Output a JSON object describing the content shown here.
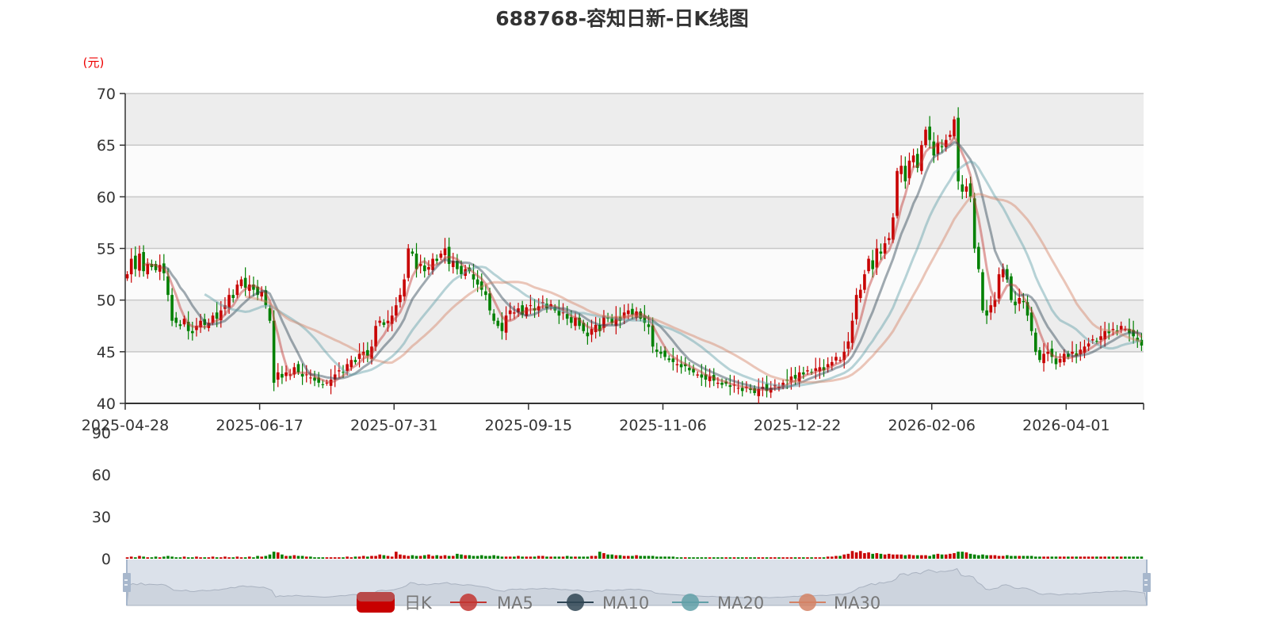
{
  "title": "688768-容知日新-日K线图",
  "unit_label": "(元)",
  "legend": [
    "日K",
    "MA5",
    "MA10",
    "MA20",
    "MA30"
  ],
  "colors": {
    "up": "#c80000",
    "down": "#008000",
    "MA5": "#c23531",
    "MA10": "#2f4554",
    "MA20": "#61a0a8",
    "MA30": "#d48265"
  },
  "chart_data": {
    "type": "candlestick",
    "title": "688768-容知日新-日K线图",
    "ylabel": "(元)",
    "ylim": [
      40,
      70
    ],
    "y_ticks": [
      "70",
      "65",
      "60",
      "55",
      "50",
      "45",
      "40"
    ],
    "volume_ylim": [
      0,
      90
    ],
    "volume_ticks": [
      "90",
      "60",
      "30",
      "0"
    ],
    "x_tick_labels": [
      "2025-04-28",
      "2025-06-17",
      "2025-07-31",
      "2025-09-15",
      "2025-11-06",
      "2025-12-22",
      "2026-02-06",
      "2026-04-01"
    ],
    "x_tick_every": 33,
    "ma_periods": [
      5,
      10,
      20,
      30
    ],
    "close": [
      52.5,
      54,
      53,
      54.5,
      52.8,
      53.5,
      53.2,
      52.9,
      53.4,
      52.6,
      50.5,
      48,
      47.8,
      47.5,
      48.2,
      47,
      46.8,
      47.5,
      48,
      47.6,
      47.8,
      48.5,
      48.2,
      49,
      49.5,
      50.5,
      50.2,
      51.5,
      52,
      51.2,
      51.5,
      51,
      50.5,
      50.8,
      49.5,
      48,
      42,
      43,
      42.5,
      43,
      42.8,
      43.5,
      43,
      42.6,
      42.8,
      42.5,
      42.2,
      42,
      41.8,
      42,
      42.3,
      42.8,
      43.2,
      43,
      43.8,
      44.2,
      44,
      44.8,
      45,
      44.6,
      45.5,
      47.5,
      48,
      47.6,
      48,
      48.5,
      49.5,
      50.5,
      52,
      55,
      54.5,
      53,
      53.5,
      52.8,
      53.2,
      54,
      53.8,
      54.5,
      55,
      53.5,
      53.8,
      53,
      52.5,
      53,
      52.8,
      52,
      51.5,
      51,
      50.5,
      49,
      48,
      47.5,
      47,
      48.5,
      49,
      48.8,
      49.2,
      48.6,
      49.3,
      49.5,
      49,
      49.4,
      49.8,
      49.2,
      49.6,
      49,
      48.5,
      48.8,
      48.2,
      47.8,
      48.3,
      47.5,
      47,
      46.5,
      47.2,
      47.6,
      47,
      48.5,
      48.2,
      47.8,
      48.4,
      48,
      48.8,
      49,
      48.6,
      48.9,
      48.2,
      47.8,
      47.4,
      45.5,
      45,
      44.8,
      44.5,
      44.2,
      44,
      43.8,
      43.5,
      43.6,
      43.2,
      43,
      42.8,
      42.5,
      42.3,
      42.6,
      42.2,
      42,
      41.8,
      41.9,
      41.6,
      41.8,
      41.5,
      41.2,
      41.6,
      41.3,
      41,
      41.4,
      41.6,
      41.2,
      41.5,
      41.8,
      41.6,
      42,
      42.2,
      42.6,
      42.4,
      43,
      42.8,
      43.2,
      43,
      43.4,
      43.5,
      43.2,
      43.8,
      44,
      44.5,
      44.2,
      45,
      46,
      48,
      50.5,
      51,
      52.5,
      54,
      53,
      55,
      54.5,
      55.5,
      56,
      58,
      62.5,
      63,
      61.5,
      63.5,
      64,
      62.8,
      65,
      66.5,
      65.5,
      64,
      65.2,
      64.8,
      65.5,
      66,
      67.5,
      61.5,
      60.5,
      61,
      60,
      55,
      53,
      49,
      48.5,
      49.5,
      50,
      52.5,
      53,
      52,
      50,
      49.5,
      50.2,
      49.8,
      48.5,
      47,
      45,
      44.2,
      44.8,
      45,
      44.5,
      43.8,
      44.3,
      44.8,
      44.5,
      45,
      44.6,
      45.2,
      45.5,
      45.8,
      46.2,
      46,
      46.5,
      47,
      46.8,
      47.2,
      47,
      47.5,
      47.2,
      46.8,
      46.5,
      46,
      45.6
    ],
    "volume": [
      1,
      1.5,
      1,
      2,
      1.5,
      1,
      1,
      1.5,
      1,
      1.5,
      2,
      1.5,
      1,
      1,
      1.5,
      1,
      1,
      1.5,
      1,
      1,
      1,
      1.5,
      1,
      1,
      1.5,
      1,
      1,
      1.5,
      1,
      1,
      1.5,
      1,
      2,
      1.5,
      2,
      3,
      5,
      4.5,
      3,
      2,
      2,
      2.5,
      2,
      2,
      1.5,
      1.5,
      1,
      1,
      1,
      1,
      1,
      1,
      1,
      1,
      1.5,
      1,
      1.5,
      1.5,
      2,
      1.5,
      2,
      2,
      3,
      2.5,
      2,
      1.5,
      5,
      3,
      2.5,
      2,
      2.5,
      2,
      2,
      2.5,
      3,
      2,
      2.5,
      2,
      2.5,
      2,
      2,
      3.5,
      3,
      2.5,
      2.5,
      2,
      2,
      2.5,
      2,
      2,
      2.5,
      2,
      1.5,
      1.5,
      1.5,
      1.5,
      2,
      1.5,
      1.5,
      1.5,
      1.5,
      2,
      2,
      1.5,
      1.5,
      1.5,
      1.5,
      1.5,
      2,
      1.5,
      1.5,
      1.5,
      1.5,
      1.5,
      2,
      2,
      5,
      4,
      3,
      3,
      2.5,
      2.5,
      2,
      2,
      2,
      2.5,
      2,
      2,
      2,
      2,
      1.5,
      1.5,
      1.5,
      1.5,
      1.5,
      1,
      1,
      1,
      1,
      1,
      1,
      1,
      1,
      1,
      1,
      1,
      1,
      1,
      1,
      1,
      1,
      1,
      1,
      1,
      1,
      1,
      1,
      1,
      1,
      1,
      1,
      1,
      1,
      1,
      1,
      1,
      1,
      1,
      1,
      1,
      1,
      1,
      1.5,
      1.5,
      2,
      2,
      3,
      3.5,
      5.5,
      4.5,
      5.5,
      4,
      4.5,
      3.5,
      4,
      3.5,
      3,
      3.5,
      3,
      3,
      3,
      2.5,
      3,
      2.5,
      2.5,
      2.5,
      2.5,
      2,
      3,
      3.5,
      3,
      3,
      3.5,
      4,
      5,
      5,
      4.5,
      3.5,
      3,
      2.5,
      3,
      2.5,
      2.5,
      2.5,
      2,
      2,
      2.5,
      2,
      2,
      2,
      2,
      2,
      2,
      1.5,
      1.5,
      1.5,
      1.5,
      1.5,
      1.5,
      1.5,
      1.5,
      1.5,
      1.5,
      1.5,
      1.5,
      1.5,
      1.5,
      1.5,
      1.5,
      1.5,
      1.5,
      1.5,
      1.5,
      1.5,
      1.5,
      1.5,
      1.5,
      1.5,
      1.5,
      1.5
    ]
  }
}
